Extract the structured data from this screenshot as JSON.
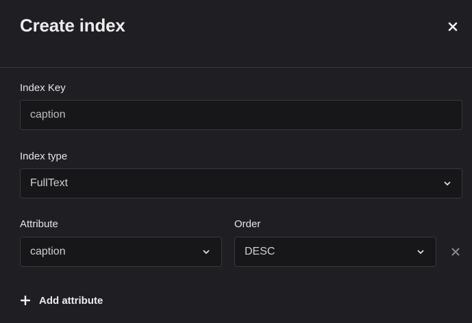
{
  "dialog": {
    "title": "Create index",
    "close_icon": "close-icon"
  },
  "index_key": {
    "label": "Index Key",
    "value": "caption"
  },
  "index_type": {
    "label": "Index type",
    "value": "FullText"
  },
  "attribute": {
    "label": "Attribute",
    "value": "caption"
  },
  "order": {
    "label": "Order",
    "value": "DESC"
  },
  "actions": {
    "add_attribute_label": "Add attribute",
    "remove_icon": "close-icon",
    "add_icon": "plus-icon"
  },
  "colors": {
    "background": "#1f1f23",
    "field_background": "#17171a",
    "border": "#38383d"
  }
}
